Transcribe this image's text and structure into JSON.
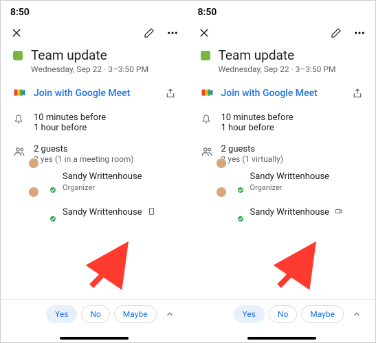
{
  "panes": [
    {
      "status": {
        "time": "8:50"
      },
      "event": {
        "title": "Team update",
        "subtitle": "Wednesday, Sep 22 · 3–3:50 PM",
        "join_label": "Join with Google Meet",
        "reminders": {
          "line1": "10 minutes before",
          "line2": "1 hour before"
        },
        "guests": {
          "count_line": "2 guests",
          "status_line": "2 yes (1 in a meeting room)",
          "list": [
            {
              "name": "Sandy Writtenhouse",
              "role": "Organizer"
            },
            {
              "name": "Sandy Writtenhouse",
              "icon": "room"
            }
          ]
        }
      },
      "rsvp": {
        "yes": "Yes",
        "no": "No",
        "maybe": "Maybe"
      }
    },
    {
      "status": {
        "time": "8:50"
      },
      "event": {
        "title": "Team update",
        "subtitle": "Wednesday, Sep 22 · 3–3:50 PM",
        "join_label": "Join with Google Meet",
        "reminders": {
          "line1": "10 minutes before",
          "line2": "1 hour before"
        },
        "guests": {
          "count_line": "2 guests",
          "status_line": "2 yes (1 virtually)",
          "list": [
            {
              "name": "Sandy Writtenhouse",
              "role": "Organizer"
            },
            {
              "name": "Sandy Writtenhouse",
              "icon": "video"
            }
          ]
        }
      },
      "rsvp": {
        "yes": "Yes",
        "no": "No",
        "maybe": "Maybe"
      }
    }
  ]
}
